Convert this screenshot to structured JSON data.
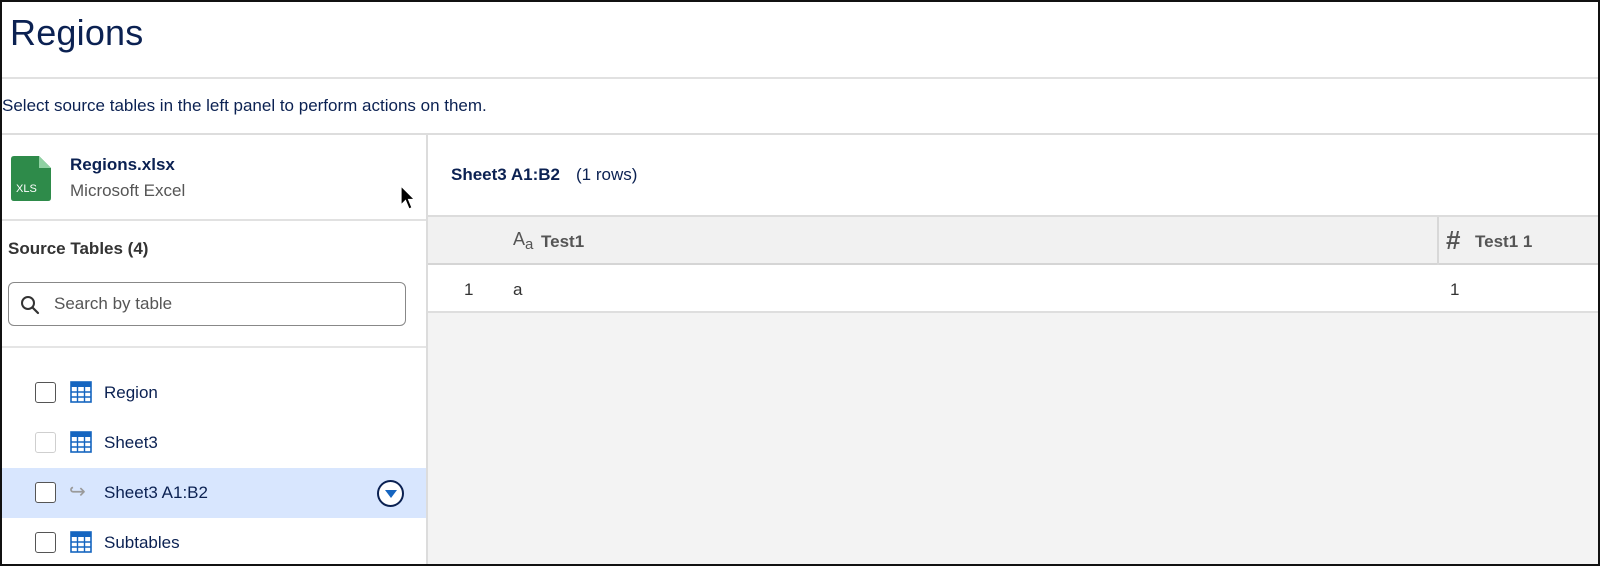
{
  "page": {
    "title": "Regions",
    "hint": "Select source tables in the left panel to perform actions on them."
  },
  "file": {
    "name": "Regions.xlsx",
    "type": "Microsoft Excel",
    "icon": "xls-file-icon",
    "icon_label": "XLS",
    "icon_color": "#2e8b4a"
  },
  "source_tables": {
    "title": "Source Tables (4)",
    "search_placeholder": "Search by table",
    "items": [
      {
        "label": "Region",
        "icon": "table-icon",
        "checked": false,
        "disabled": false,
        "selected": false
      },
      {
        "label": "Sheet3",
        "icon": "table-icon",
        "checked": false,
        "disabled": true,
        "selected": false
      },
      {
        "label": "Sheet3 A1:B2",
        "icon": "subtable-arrow-icon",
        "checked": false,
        "disabled": false,
        "selected": true
      },
      {
        "label": "Subtables",
        "icon": "table-icon",
        "checked": false,
        "disabled": false,
        "selected": false
      }
    ]
  },
  "preview": {
    "table_name": "Sheet3 A1:B2",
    "row_count": "(1 rows)",
    "columns": [
      {
        "label": "Test1",
        "type_icon": "text-type-icon",
        "type_glyph": "A",
        "type_glyph_sub": "a"
      },
      {
        "label": "Test1 1",
        "type_icon": "number-type-icon",
        "type_glyph": "#"
      }
    ],
    "rows": [
      {
        "num": "1",
        "cells": [
          "a",
          "1"
        ]
      }
    ]
  },
  "colors": {
    "title_navy": "#0b2152",
    "selected_bg": "#d8e6fe",
    "accent_blue": "#1565c0",
    "preview_bg": "#f3f3f3"
  }
}
